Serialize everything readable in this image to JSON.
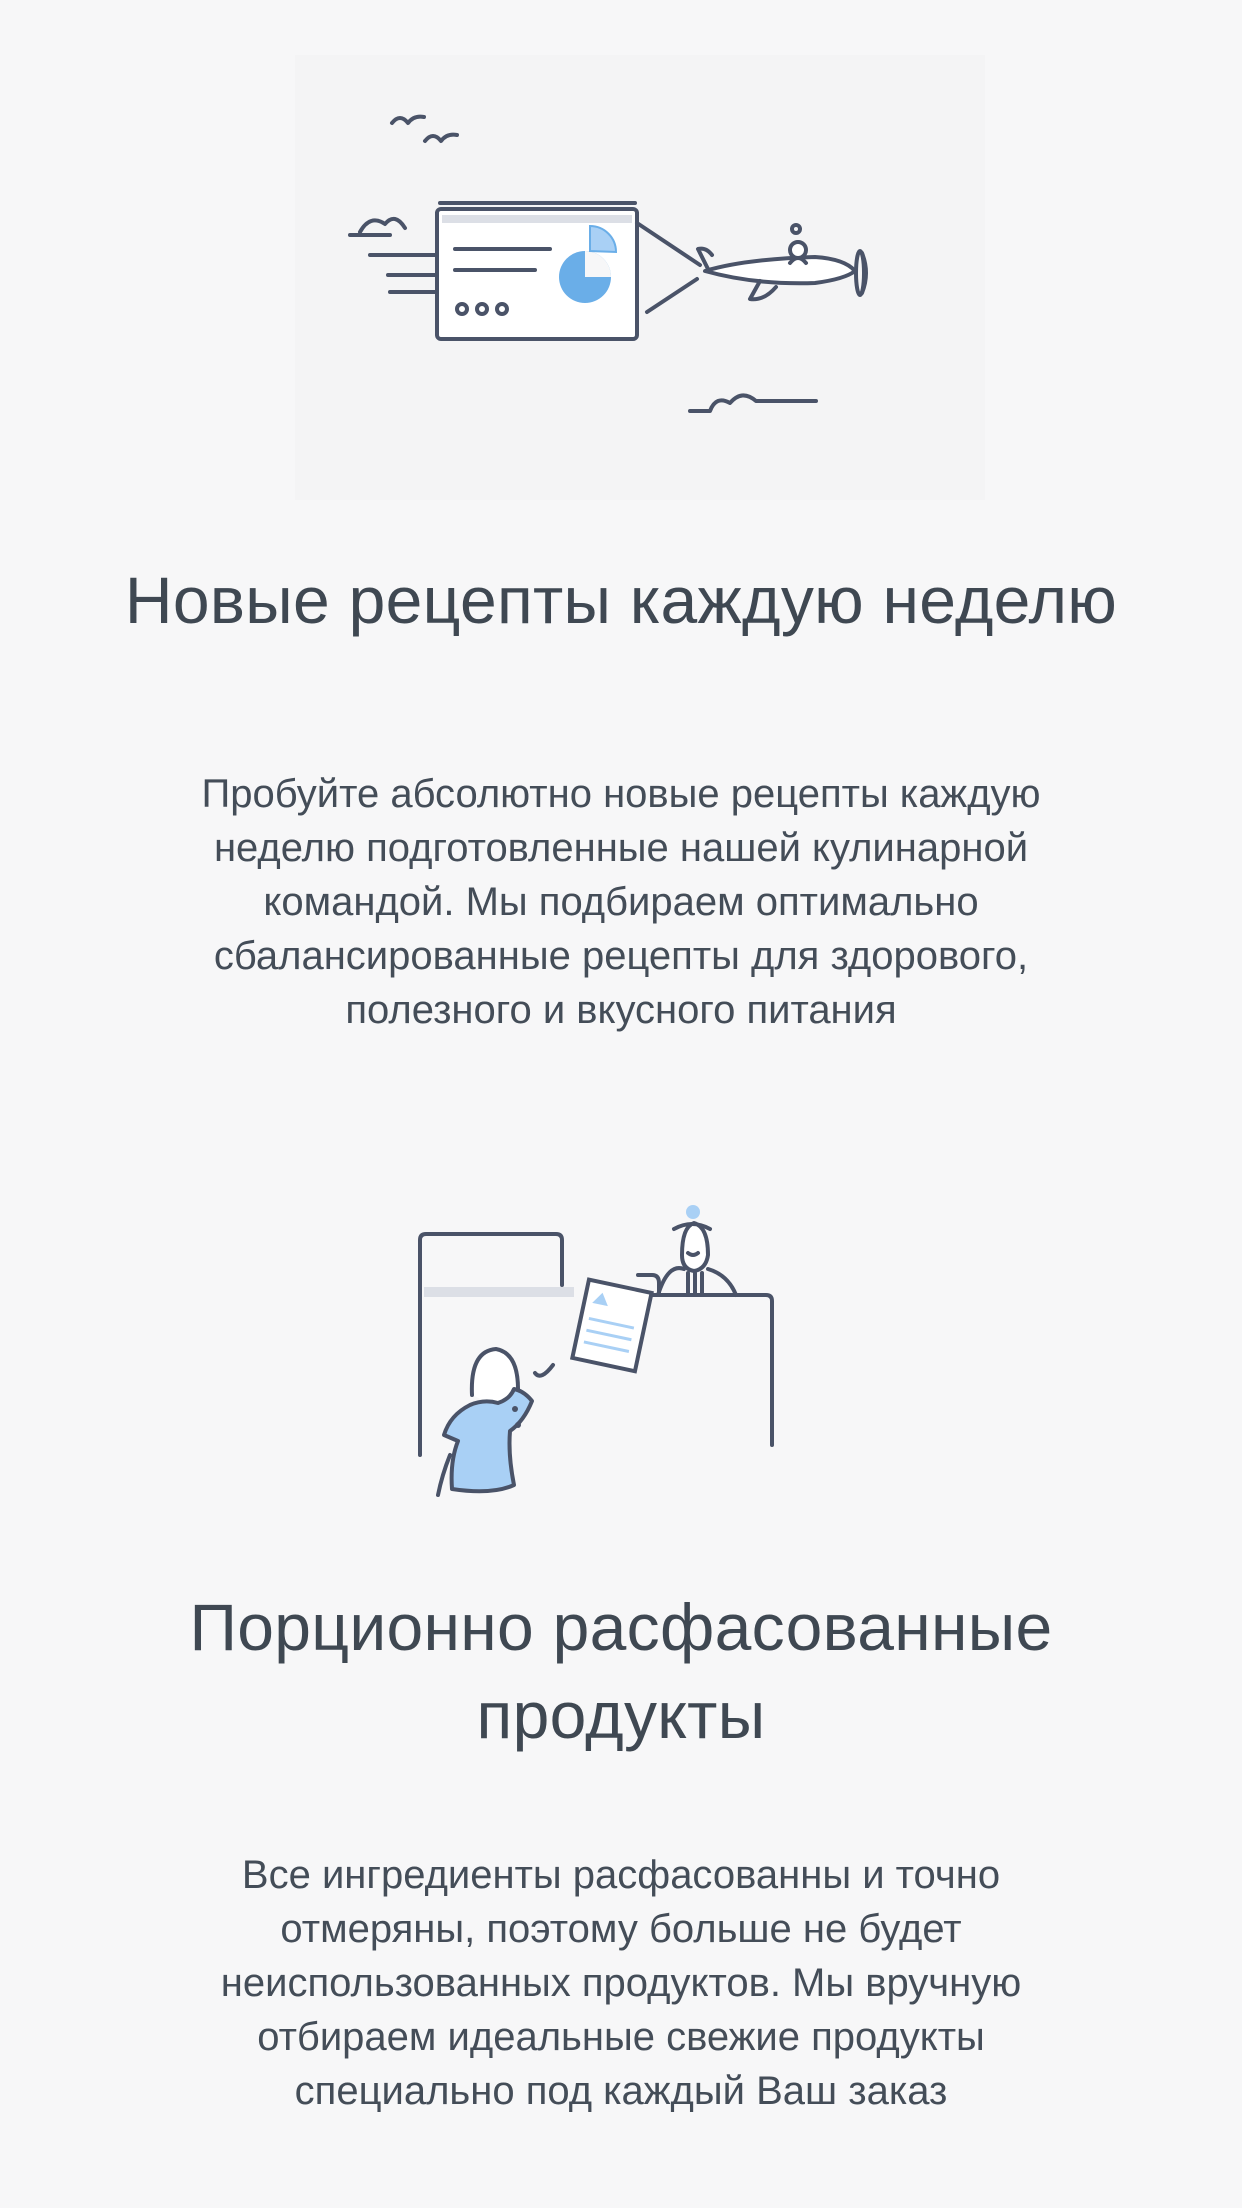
{
  "colors": {
    "background": "#f7f7f8",
    "text": "#3f4852",
    "ink": "#4a5368",
    "accent_blue": "#6aaee8",
    "light_blue": "#a9d0f5"
  },
  "features": [
    {
      "illustration": "airplane-pulling-report-banner-illustration",
      "title": "Новые рецепты каждую неделю",
      "description": "Пробуйте абсолютно новые рецепты каждую неделю подготовленные нашей кулинарной командой. Мы подбираем оптимально сбалансированные рецепты для здорового, полезного и вкусного питания"
    },
    {
      "illustration": "person-handing-document-illustration",
      "title": "Порционно расфасованные продукты",
      "description": "Все ингредиенты расфасованны и точно отмеряны, поэтому больше не будет неиспользованных продуктов. Мы вручную отбираем идеальные свежие продукты специально под каждый Ваш заказ"
    }
  ]
}
